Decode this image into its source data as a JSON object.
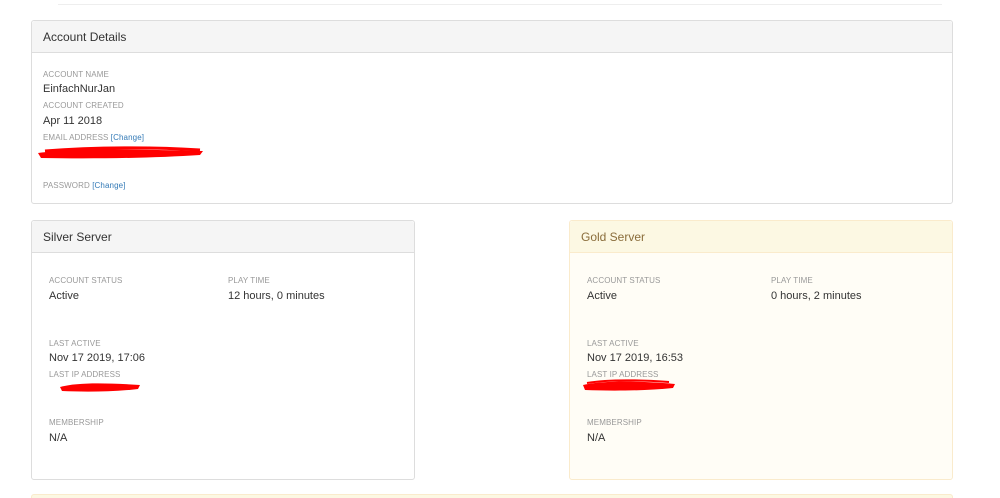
{
  "account_details": {
    "title": "Account Details",
    "account_name_label": "ACCOUNT NAME",
    "account_name": "EinfachNurJan",
    "account_created_label": "ACCOUNT CREATED",
    "account_created": "Apr 11 2018",
    "email_label": "EMAIL ADDRESS",
    "email_change": "[Change]",
    "password_label": "PASSWORD",
    "password_change": "[Change]"
  },
  "silver_server": {
    "title": "Silver Server",
    "account_status_label": "ACCOUNT STATUS",
    "account_status": "Active",
    "play_time_label": "PLAY TIME",
    "play_time": "12 hours, 0 minutes",
    "last_active_label": "LAST ACTIVE",
    "last_active": "Nov 17 2019, 17:06",
    "last_ip_label": "LAST IP ADDRESS",
    "membership_label": "MEMBERSHIP",
    "membership": "N/A"
  },
  "gold_server": {
    "title": "Gold Server",
    "account_status_label": "ACCOUNT STATUS",
    "account_status": "Active",
    "play_time_label": "PLAY TIME",
    "play_time": "0 hours, 2 minutes",
    "last_active_label": "LAST ACTIVE",
    "last_active": "Nov 17 2019, 16:53",
    "last_ip_label": "LAST IP ADDRESS",
    "membership_label": "MEMBERSHIP",
    "membership": "N/A"
  },
  "colors": {
    "panel_border": "#dddddd",
    "panel_heading_bg": "#f5f5f5",
    "gold_heading_bg": "#fcf8e3",
    "gold_heading_text": "#8a6d3b",
    "gold_border": "#faebcc",
    "link": "#337ab7",
    "label": "#999999",
    "redaction": "#ff0000"
  }
}
